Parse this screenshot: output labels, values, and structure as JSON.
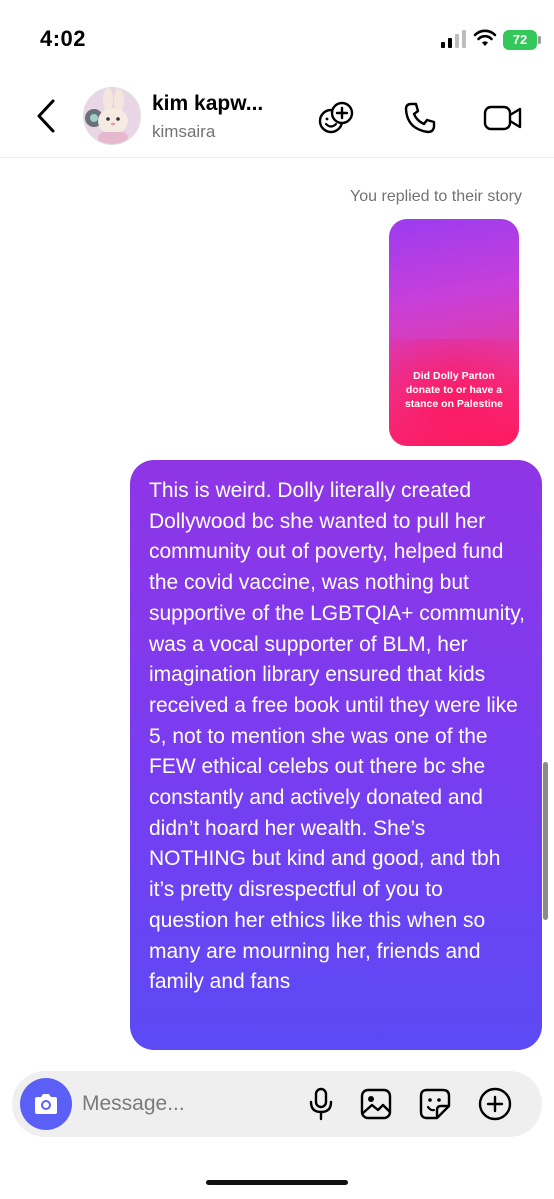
{
  "status_bar": {
    "time": "4:02",
    "battery": "72"
  },
  "header": {
    "back_icon": "chevron-left-icon",
    "name": "kim kapw...",
    "handle": "kimsaira",
    "actions": [
      "add-effect-icon",
      "phone-icon",
      "video-camera-icon"
    ]
  },
  "chat": {
    "reply_label": "You replied to their story",
    "story_text": "Did Dolly Parton donate to or have a stance on Palestine",
    "message": "This is weird. Dolly literally created Dollywood bc she wanted to pull her community out of poverty, helped fund the covid vaccine, was nothing but supportive of the LGBTQIA+ community, was a vocal supporter of BLM, her imagination library ensured that kids received a free book until they were like 5, not to mention she was one of the FEW ethical celebs out there bc she constantly and actively donated and didn’t hoard her wealth. She’s NOTHING but kind and good, and tbh it’s pretty disrespectful of you to question her ethics like this when so many are mourning her, friends and family and fans"
  },
  "composer": {
    "placeholder": "Message...",
    "icons": [
      "camera-icon",
      "microphone-icon",
      "gallery-icon",
      "sticker-icon",
      "plus-icon"
    ]
  },
  "colors": {
    "bubble_top": "#8f35e6",
    "bubble_bottom": "#5b4af5",
    "camera_button": "#5b5ff5",
    "battery": "#34c759"
  }
}
